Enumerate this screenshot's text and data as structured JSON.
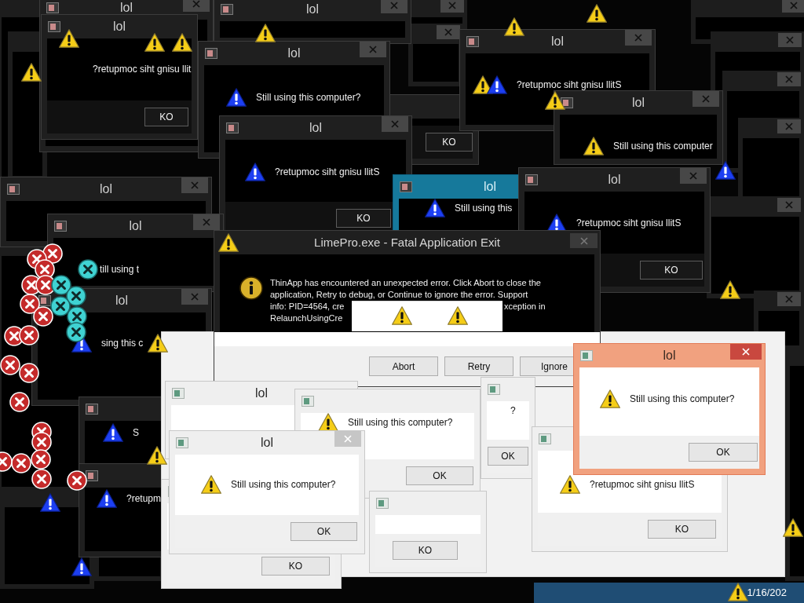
{
  "windows": [
    {
      "kind": "dark",
      "title": "lol"
    },
    {
      "kind": "dark",
      "title": "lol"
    },
    {
      "kind": "dark",
      "title": "lol",
      "message": "?retupmoc siht gnisu llit",
      "buttons": [
        "KO"
      ]
    },
    {
      "kind": "dark",
      "buttons": [
        "KO"
      ]
    },
    {
      "kind": "dark",
      "title": "lol",
      "message": "Still using this computer?"
    },
    {
      "kind": "dark",
      "title": "lol",
      "message": "?retupmoc siht gnisu llitS",
      "buttons": [
        "KO"
      ]
    },
    {
      "kind": "dark",
      "title": "lol"
    },
    {
      "kind": "dark",
      "title": "lol",
      "message": "till using t"
    },
    {
      "kind": "dark",
      "title": "lol",
      "message": "sing this c"
    },
    {
      "kind": "dark",
      "message": "S"
    },
    {
      "kind": "dark",
      "message": "?retupm"
    },
    {
      "kind": "dark",
      "title": "lol",
      "message": "?retupmoc siht gnisu llitS"
    },
    {
      "kind": "dark",
      "title": "lol",
      "message": "Still using this computer"
    },
    {
      "kind": "teal",
      "title": "lol",
      "message": "Still using this"
    },
    {
      "kind": "dark",
      "title": "lol",
      "message": "?retupmoc siht gnisu llitS",
      "buttons": [
        "KO"
      ]
    },
    {
      "kind": "fatal",
      "title": "LimePro.exe - Fatal Application Exit",
      "message_lines": [
        [
          "ThinApp has encountered an unexpected error. Click Abort to close the"
        ],
        [
          "application, Retry to debug, or Continue to ignore the error. Support"
        ],
        [
          "info: PID=4564, cre",
          "xception in"
        ],
        [
          "RelaunchUsingCre"
        ]
      ],
      "buttons": [
        "Abort",
        "Retry",
        "Ignore"
      ]
    },
    {
      "kind": "light",
      "title": "lol"
    },
    {
      "kind": "light",
      "message": "?",
      "buttons": [
        "OK"
      ]
    },
    {
      "kind": "light",
      "message": "Still using this computer?",
      "buttons": [
        "OK"
      ]
    },
    {
      "kind": "light",
      "buttons": [
        "KO"
      ]
    },
    {
      "kind": "light",
      "buttons": [
        "KO"
      ]
    },
    {
      "kind": "light",
      "title": "lol",
      "message": "Still using this computer?",
      "buttons": [
        "OK"
      ]
    },
    {
      "kind": "light",
      "message": "?retupmoc siht gnisu llitS",
      "buttons": [
        "KO"
      ]
    },
    {
      "kind": "orange",
      "title": "lol",
      "message": "Still using this computer?",
      "buttons": [
        "OK"
      ]
    }
  ],
  "taskbar": {
    "clock": "1/16/202"
  }
}
